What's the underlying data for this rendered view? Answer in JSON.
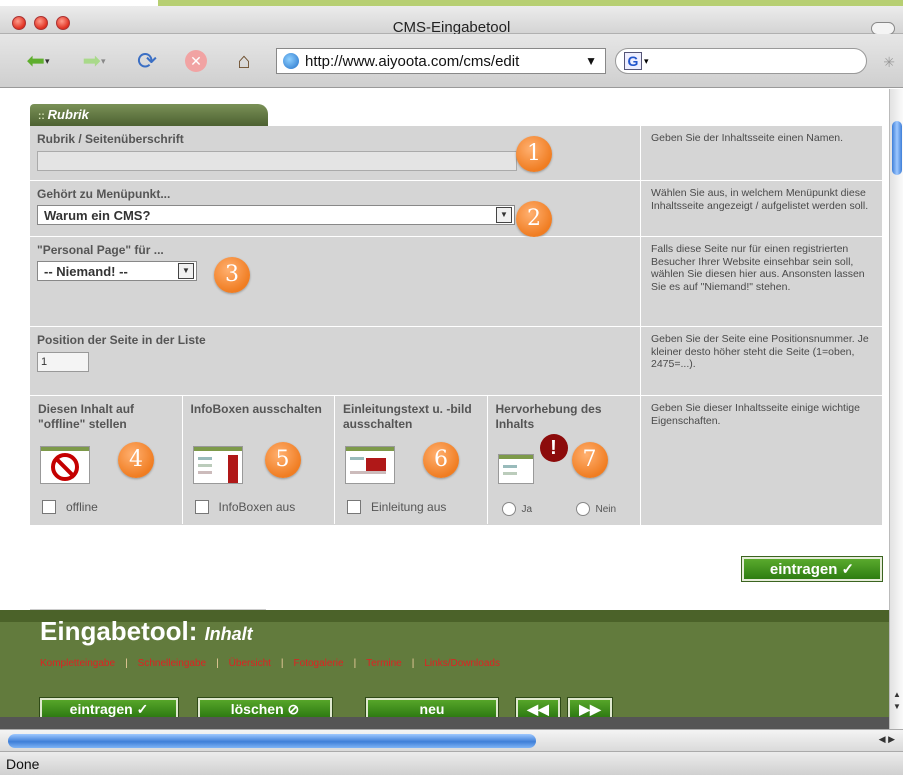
{
  "window": {
    "title": "CMS-Eingabetool"
  },
  "browser": {
    "url": "http://www.aiyoota.com/cms/edit",
    "search_engine_glyph": "G",
    "status": "Done",
    "colors": {
      "chrome_accent": "#b7cf72"
    }
  },
  "tab": {
    "label": "Rubrik"
  },
  "rows": {
    "title": {
      "label": "Rubrik / Seitenüberschrift",
      "value": "",
      "help": "Geben Sie der Inhaltsseite einen Namen.",
      "badge": "1"
    },
    "menu": {
      "label": "Gehört zu Menüpunkt...",
      "selected": "Warum ein CMS?",
      "help": "Wählen Sie aus, in welchem Menüpunkt diese Inhaltsseite angezeigt / aufgelistet werden soll.",
      "badge": "2"
    },
    "personal": {
      "label": "\"Personal Page\" für ...",
      "selected": "-- Niemand! --",
      "help": "Falls diese Seite nur für einen registrierten Besucher Ihrer Website einsehbar sein soll, wählen Sie diesen hier aus. Ansonsten lassen Sie es auf \"Niemand!\" stehen.",
      "badge": "3"
    },
    "position": {
      "label": "Position der Seite in der Liste",
      "value": "1",
      "help": "Geben Sie der Seite eine Positionsnummer. Je kleiner desto höher steht die Seite (1=oben, 2475=...)."
    },
    "properties": {
      "help": "Geben Sie dieser Inhaltsseite einige wichtige Eigenschaften.",
      "offline": {
        "label": "Diesen Inhalt auf \"offline\" stellen",
        "checkbox_label": "offline",
        "checked": false,
        "badge": "4"
      },
      "infoboxen": {
        "label": "InfoBoxen ausschalten",
        "checkbox_label": "InfoBoxen aus",
        "checked": false,
        "badge": "5"
      },
      "einleitung": {
        "label": "Einleitungstext u. -bild ausschalten",
        "checkbox_label": "Einleitung aus",
        "checked": false,
        "badge": "6"
      },
      "hervorhebung": {
        "label": "Hervorhebung des Inhalts",
        "option_yes": "Ja",
        "option_no": "Nein",
        "selected": null,
        "badge": "7"
      }
    }
  },
  "submit": {
    "label": "eintragen ✓"
  },
  "footer": {
    "title": "Eingabetool:",
    "subtitle": "Inhalt",
    "links": [
      "Kompletteingabe",
      "Schnelleingabe",
      "Übersicht",
      "Fotogalerie",
      "Termine",
      "Links/Downloads"
    ],
    "buttons": {
      "eintragen": "eintragen ✓",
      "loeschen": "löschen ⊘",
      "neu": "neu",
      "prev": "◀◀",
      "next": "▶▶"
    },
    "colors": {
      "panel": "#627b3d",
      "button": "#3f8f1c",
      "links": "#dd2222"
    }
  },
  "badge_color": "#f07d22"
}
